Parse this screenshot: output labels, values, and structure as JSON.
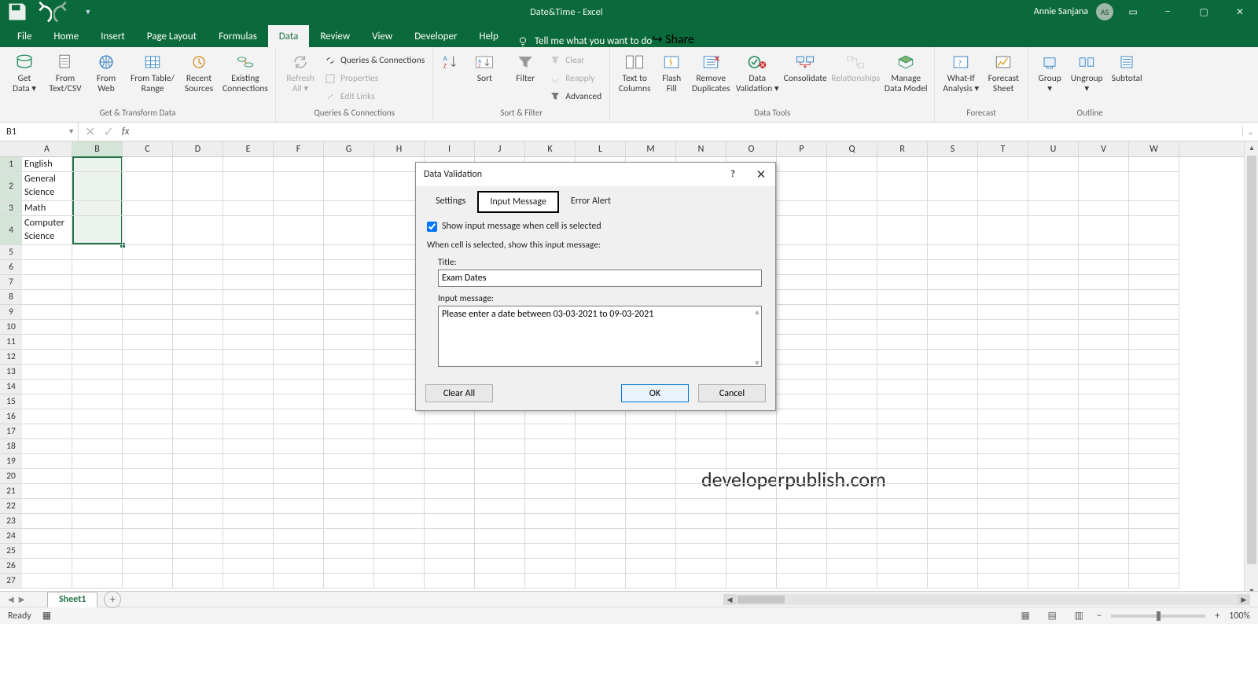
{
  "titlebar": {
    "title": "Date&Time  -  Excel",
    "user": "Annie Sanjana",
    "avatar": "AS"
  },
  "tabs": {
    "file": "File",
    "home": "Home",
    "insert": "Insert",
    "pagelayout": "Page Layout",
    "formulas": "Formulas",
    "data": "Data",
    "review": "Review",
    "view": "View",
    "developer": "Developer",
    "help": "Help",
    "tellme": "Tell me what you want to do"
  },
  "share": "Share",
  "ribbon": {
    "getdata": "Get\nData ▾",
    "fromtextcsv": "From\nText/CSV",
    "fromweb": "From\nWeb",
    "fromtable": "From Table/\nRange",
    "recent": "Recent\nSources",
    "existing": "Existing\nConnections",
    "group_get": "Get & Transform Data",
    "refresh": "Refresh\nAll ▾",
    "qc": "Queries & Connections",
    "props": "Properties",
    "editlinks": "Edit Links",
    "group_qc": "Queries & Connections",
    "sort": "Sort",
    "filter": "Filter",
    "clear": "Clear",
    "reapply": "Reapply",
    "advanced": "Advanced",
    "group_sf": "Sort & Filter",
    "t2c": "Text to\nColumns",
    "flash": "Flash\nFill",
    "rdup": "Remove\nDuplicates",
    "dval": "Data\nValidation ▾",
    "consol": "Consolidate",
    "rel": "Relationships",
    "mdm": "Manage\nData Model",
    "group_dt": "Data Tools",
    "whatif": "What-If\nAnalysis ▾",
    "fsheet": "Forecast\nSheet",
    "group_fc": "Forecast",
    "grp": "Group\n▾",
    "ungrp": "Ungroup\n▾",
    "subt": "Subtotal",
    "group_ol": "Outline"
  },
  "namebox": "B1",
  "columns": [
    "A",
    "B",
    "C",
    "D",
    "E",
    "F",
    "G",
    "H",
    "I",
    "J",
    "K",
    "L",
    "M",
    "N",
    "O",
    "P",
    "Q",
    "R",
    "S",
    "T",
    "U",
    "V",
    "W"
  ],
  "rows": [
    "1",
    "2",
    "3",
    "4",
    "5",
    "6",
    "7",
    "8",
    "9",
    "10",
    "11",
    "12",
    "13",
    "14",
    "15",
    "16",
    "17",
    "18",
    "19",
    "20",
    "21",
    "22",
    "23",
    "24",
    "25",
    "26",
    "27"
  ],
  "cells": {
    "a1": "English",
    "a2": "General Science",
    "a3": "Math",
    "a4": "Computer Science"
  },
  "watermark": "developerpublish.com",
  "dialog": {
    "title": "Data Validation",
    "tabs": {
      "settings": "Settings",
      "input": "Input Message",
      "error": "Error Alert"
    },
    "checkbox": "Show input message when cell is selected",
    "when": "When cell is selected, show this input message:",
    "title_label": "Title:",
    "title_value": "Exam Dates",
    "msg_label": "Input message:",
    "msg_value": "Please enter a date between 03-03-2021 to 09-03-2021",
    "clear": "Clear All",
    "ok": "OK",
    "cancel": "Cancel"
  },
  "sheet": {
    "name": "Sheet1"
  },
  "status": {
    "ready": "Ready",
    "zoom": "100%"
  }
}
